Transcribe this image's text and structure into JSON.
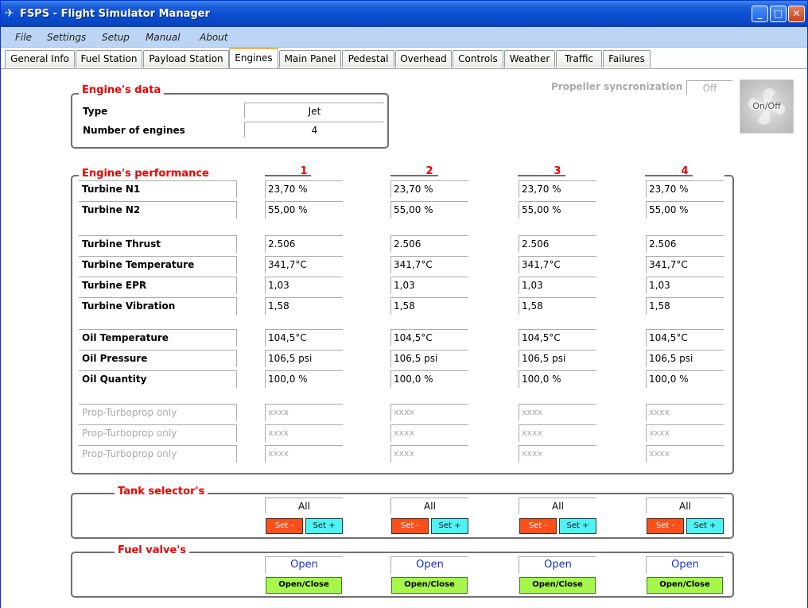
{
  "window": {
    "title": "FSPS - Flight Simulator Manager",
    "icon": "airplane-icon",
    "controls": [
      "_",
      "□",
      "✕"
    ]
  },
  "menu": [
    "File",
    "Settings",
    "Setup",
    "Manual",
    "About"
  ],
  "tabs": [
    "General Info",
    "Fuel Station",
    "Payload Station",
    "Engines",
    "Main Panel",
    "Pedestal",
    "Overhead",
    "Controls",
    "Weather",
    "Traffic",
    "Failures"
  ],
  "active_tab": "Engines",
  "engines_data": {
    "legend": "Engine's data",
    "type_label": "Type",
    "type_value": "Jet",
    "count_label": "Number of engines",
    "count_value": "4"
  },
  "propeller": {
    "label": "Propeller syncronization",
    "value": "Off",
    "button_label": "On/Off"
  },
  "performance": {
    "legend": "Engine's performance",
    "columns": [
      "1",
      "2",
      "3",
      "4"
    ],
    "rows": [
      {
        "label": "Turbine N1",
        "values": [
          "23,70 %",
          "23,70 %",
          "23,70 %",
          "23,70 %"
        ]
      },
      {
        "label": "Turbine N2",
        "values": [
          "55,00 %",
          "55,00 %",
          "55,00 %",
          "55,00 %"
        ]
      },
      {
        "label": "Turbine Thrust",
        "values": [
          "2.506",
          "2.506",
          "2.506",
          "2.506"
        ]
      },
      {
        "label": "Turbine Temperature",
        "values": [
          "341,7°C",
          "341,7°C",
          "341,7°C",
          "341,7°C"
        ]
      },
      {
        "label": "Turbine EPR",
        "values": [
          "1,03",
          "1,03",
          "1,03",
          "1,03"
        ]
      },
      {
        "label": "Turbine Vibration",
        "values": [
          "1,58",
          "1,58",
          "1,58",
          "1,58"
        ]
      },
      {
        "label": "Oil Temperature",
        "values": [
          "104,5°C",
          "104,5°C",
          "104,5°C",
          "104,5°C"
        ]
      },
      {
        "label": "Oil Pressure",
        "values": [
          "106,5 psi",
          "106,5 psi",
          "106,5 psi",
          "106,5 psi"
        ]
      },
      {
        "label": "Oil Quantity",
        "values": [
          "100,0 %",
          "100,0 %",
          "100,0 %",
          "100,0 %"
        ]
      },
      {
        "label": "Prop-Turboprop only",
        "values": [
          "xxxx",
          "xxxx",
          "xxxx",
          "xxxx"
        ],
        "disabled": true
      },
      {
        "label": "Prop-Turboprop only",
        "values": [
          "xxxx",
          "xxxx",
          "xxxx",
          "xxxx"
        ],
        "disabled": true
      },
      {
        "label": "Prop-Turboprop only",
        "values": [
          "xxxx",
          "xxxx",
          "xxxx",
          "xxxx"
        ],
        "disabled": true
      }
    ]
  },
  "tank_selectors": {
    "legend": "Tank selector's",
    "values": [
      "All",
      "All",
      "All",
      "All"
    ],
    "minus_label": "Set -",
    "plus_label": "Set +"
  },
  "fuel_valves": {
    "legend": "Fuel valve's",
    "values": [
      "Open",
      "Open",
      "Open",
      "Open"
    ],
    "button_label": "Open/Close"
  },
  "colors": {
    "legend_red": "#e00000",
    "set_minus": "#fe4f1b",
    "set_plus": "#4df3f3",
    "open_close": "#a7f64c",
    "open_text": "#1a2fce",
    "tab_active_accent": "#f7b237"
  }
}
